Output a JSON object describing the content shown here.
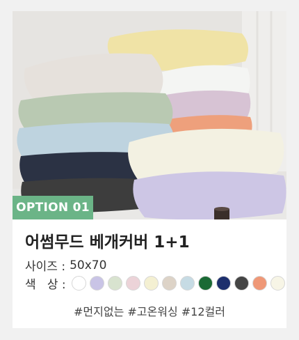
{
  "product": {
    "option_label": "OPTION 01",
    "title": "어썸무드 베개커버 1+1",
    "size_label": "사이즈 :",
    "size_value": "50x70",
    "color_label": "색   상 :",
    "tags": "#먼지없는 #고온워싱 #12컬러"
  },
  "swatch_colors": [
    "#ffffff",
    "#c9c4e6",
    "#d8e3cf",
    "#ecd3d8",
    "#f4f0d2",
    "#ddd3c7",
    "#c6dbe4",
    "#1b6a35",
    "#1d2f6d",
    "#454545",
    "#ef9877",
    "#f7f5e6"
  ],
  "photo": {
    "icon": "pillow-stack-photo",
    "pillow_colors": [
      "#f0e3a6",
      "#e6e1dc",
      "#f4f5f3",
      "#b9c9b2",
      "#d7c3d4",
      "#eea07c",
      "#bed3df",
      "#2b3244",
      "#3d3d3d",
      "#f3f1e2",
      "#cdc6e5"
    ]
  }
}
